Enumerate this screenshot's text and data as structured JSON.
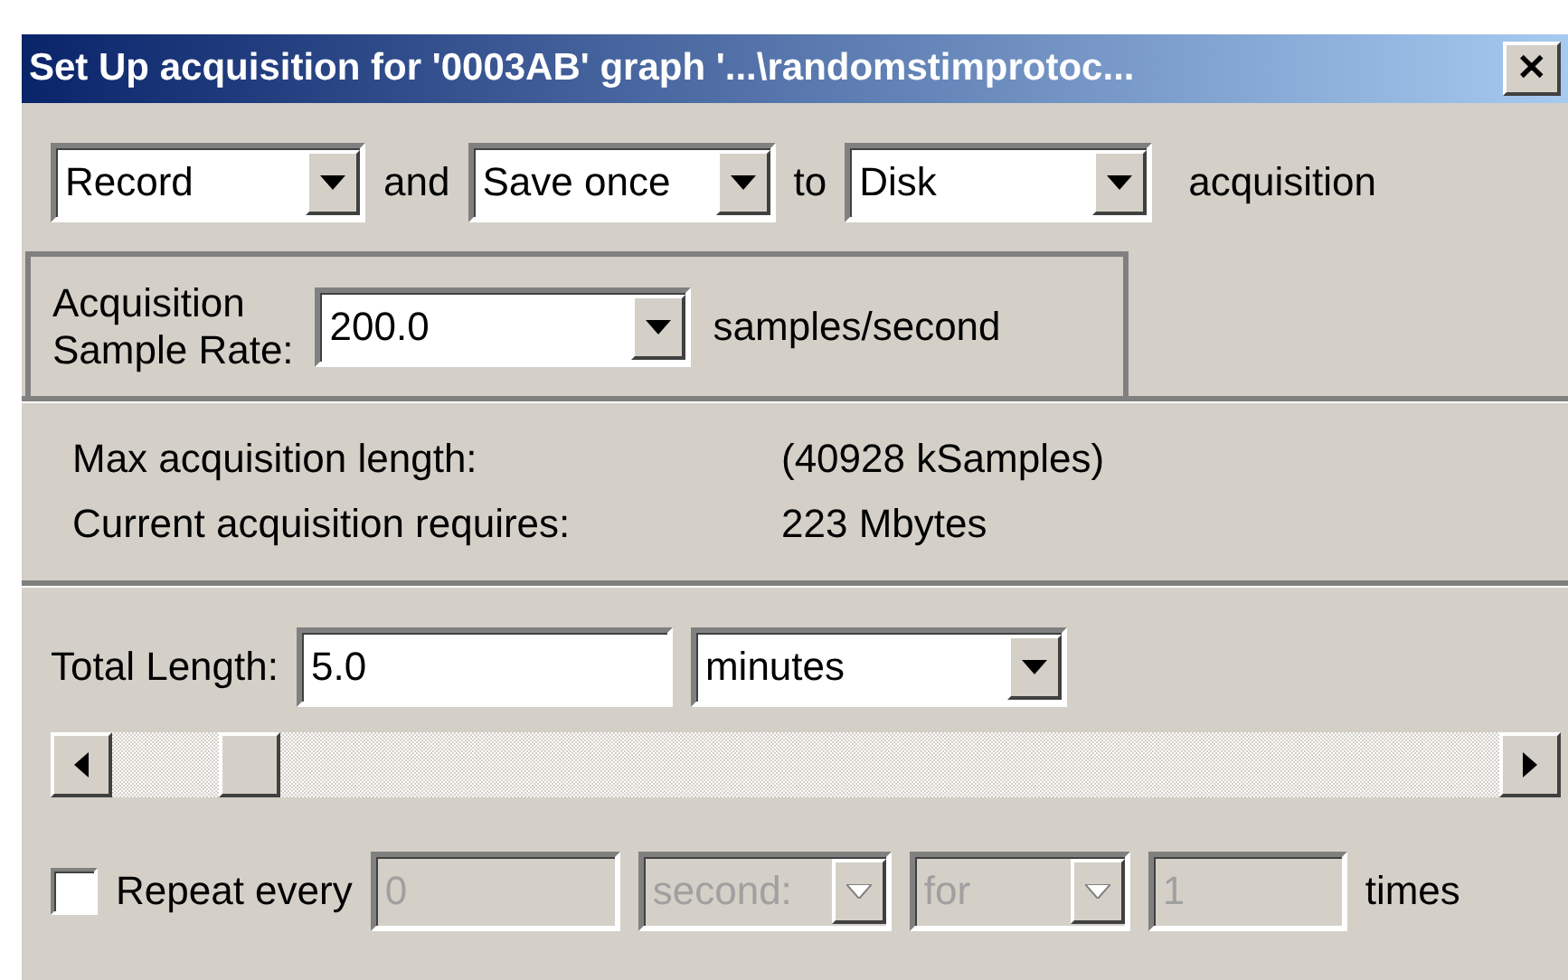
{
  "window": {
    "title": "Set Up acquisition for '0003AB' graph '...\\randomstimprotoc...",
    "close": "✕"
  },
  "mode_row": {
    "mode": {
      "value": "Record"
    },
    "and": "and",
    "save": {
      "value": "Save once"
    },
    "to": "to",
    "target": {
      "value": "Disk"
    },
    "suffix": "acquisition"
  },
  "sample_rate": {
    "label_line1": "Acquisition",
    "label_line2": "Sample Rate:",
    "value": "200.0",
    "unit": "samples/second"
  },
  "info": [
    {
      "label": "Max acquisition length:",
      "value": "(40928 kSamples)"
    },
    {
      "label": "Current acquisition requires:",
      "value": "223 Mbytes"
    }
  ],
  "total_length": {
    "label": "Total Length:",
    "value": "5.0",
    "unit": {
      "value": "minutes"
    }
  },
  "length_slider": {
    "level": 0.08
  },
  "repeat": {
    "checked": false,
    "label": "Repeat every",
    "interval": {
      "value": "0",
      "disabled": true
    },
    "unit": {
      "value": "second:",
      "disabled": true
    },
    "for_select": {
      "value": "for",
      "disabled": true
    },
    "count": {
      "value": "1",
      "disabled": true
    },
    "suffix": "times"
  }
}
